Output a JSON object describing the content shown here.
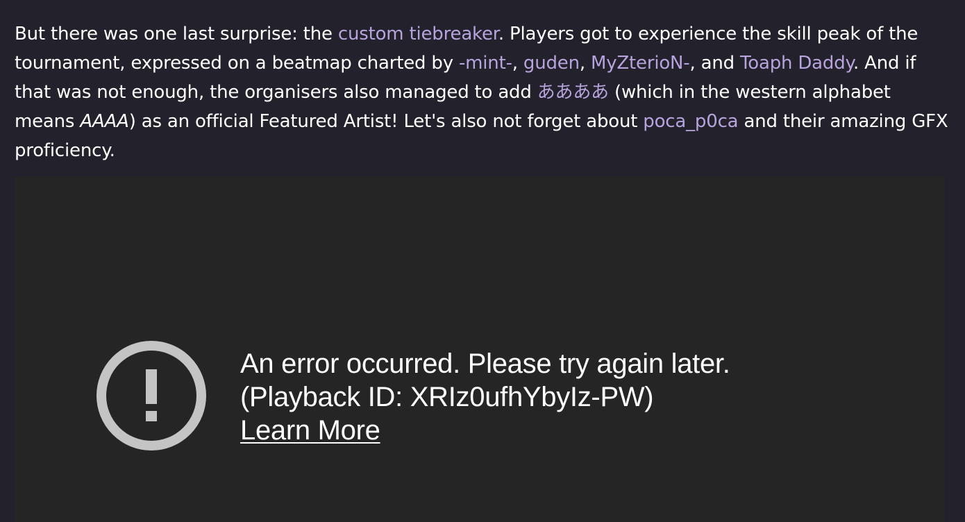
{
  "article": {
    "p1": "But there was one last surprise: the ",
    "link_tiebreaker": "custom tiebreaker",
    "p2": ". Players got to experience the skill peak of the tournament, expressed on a beatmap charted by ",
    "link_mint": "-mint-",
    "p3": ", ",
    "link_guden": "guden",
    "p4": ", ",
    "link_myzterion": "MyZterioN-",
    "p5": ", and ",
    "link_toaph": "Toaph Daddy",
    "p6": ". And if that was not enough, the organisers also managed to add ",
    "link_aaaa_artist": "ああああ",
    "p7": " (which in the western alphabet means ",
    "em_aaaa": "AAAA",
    "p8": ") as an official Featured Artist! Let's also not forget about ",
    "link_poca": "poca_p0ca",
    "p9": " and their amazing GFX proficiency."
  },
  "video": {
    "icon": "error-exclamation-icon",
    "error_message": "An error occurred. Please try again later.",
    "playback_id": "(Playback ID: XRIz0ufhYbyIz-PW)",
    "learn_more": "Learn More"
  },
  "colors": {
    "page_bg": "#22212c",
    "link": "#b7a4dd",
    "player_bg": "#252525",
    "icon": "#c4c4c4"
  }
}
